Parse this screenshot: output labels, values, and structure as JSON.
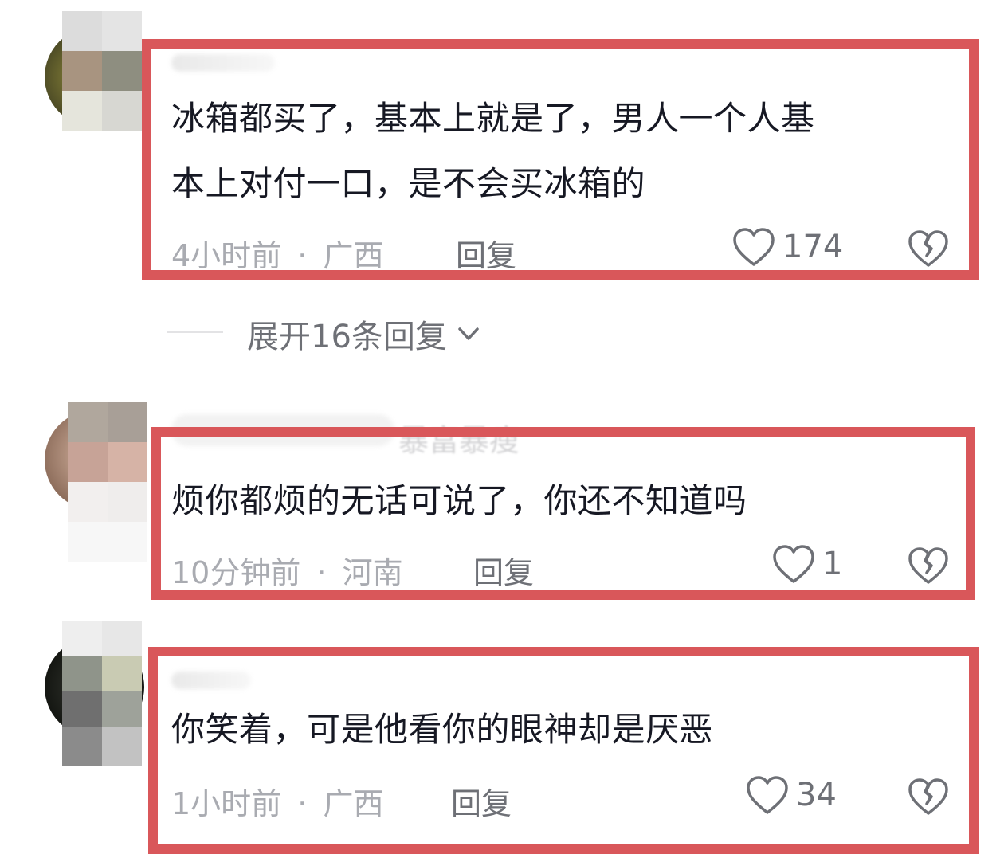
{
  "comments": [
    {
      "text_line1": "冰箱都买了，基本上就是了，男人一个人基",
      "text_line2": "本上对付一口，是不会买冰箱的",
      "time": "4小时前",
      "dot": "·",
      "location": "广西",
      "reply_label": "回复",
      "likes": "174"
    },
    {
      "username_tail": "暴富暴瘦",
      "text_line1": "烦你都烦的无话可说了，你还不知道吗",
      "time": "10分钟前",
      "dot": "·",
      "location": "河南",
      "reply_label": "回复",
      "likes": "1"
    },
    {
      "text_line1": "你笑着，可是他看你的眼神却是厌恶",
      "time": "1小时前",
      "dot": "·",
      "location": "广西",
      "reply_label": "回复",
      "likes": "34"
    }
  ],
  "expand_replies": {
    "label": "展开16条回复"
  },
  "colors": {
    "highlight": "#d9575a",
    "text": "#161823",
    "meta": "#a9abb1",
    "action": "#6e7076"
  },
  "icons": [
    "heart-outline-icon",
    "broken-heart-icon",
    "chevron-down-icon"
  ]
}
